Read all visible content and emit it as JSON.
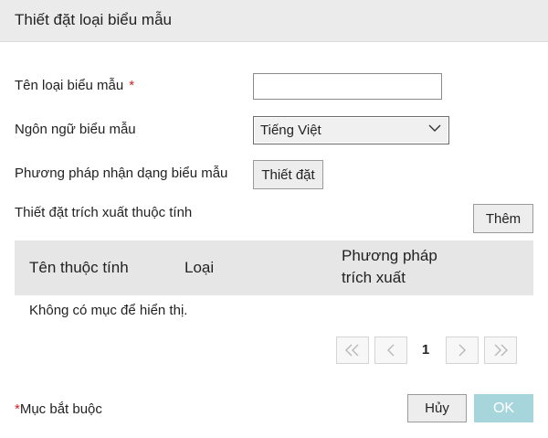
{
  "dialog": {
    "title": "Thiết đặt loại biểu mẫu"
  },
  "form": {
    "name_label": "Tên loại biểu mẫu",
    "required_mark": "*",
    "name_value": "",
    "language_label": "Ngôn ngữ biểu mẫu",
    "language_selected": "Tiếng Việt",
    "recognition_label": "Phương pháp nhận dạng biểu mẫu",
    "recognition_button": "Thiết đặt",
    "extraction_label": "Thiết đặt trích xuất thuộc tính",
    "add_button": "Thêm"
  },
  "table": {
    "columns": [
      "Tên thuộc tính",
      "Loại",
      "Phương pháp",
      "trích xuất"
    ],
    "empty_text": "Không có mục để hiển thị."
  },
  "pagination": {
    "current_page": "1",
    "icons": [
      "first-page-icon",
      "previous-page-icon",
      "next-page-icon",
      "last-page-icon"
    ]
  },
  "footer": {
    "required_star": "*",
    "required_note": "Mục bắt buộc",
    "cancel_button": "Hủy",
    "ok_button": "OK"
  },
  "colors": {
    "required": "#cc2222",
    "ok_disabled": "#a6d6dc",
    "header_bg": "#ebebeb",
    "table_header_bg": "#e6e6e6"
  }
}
